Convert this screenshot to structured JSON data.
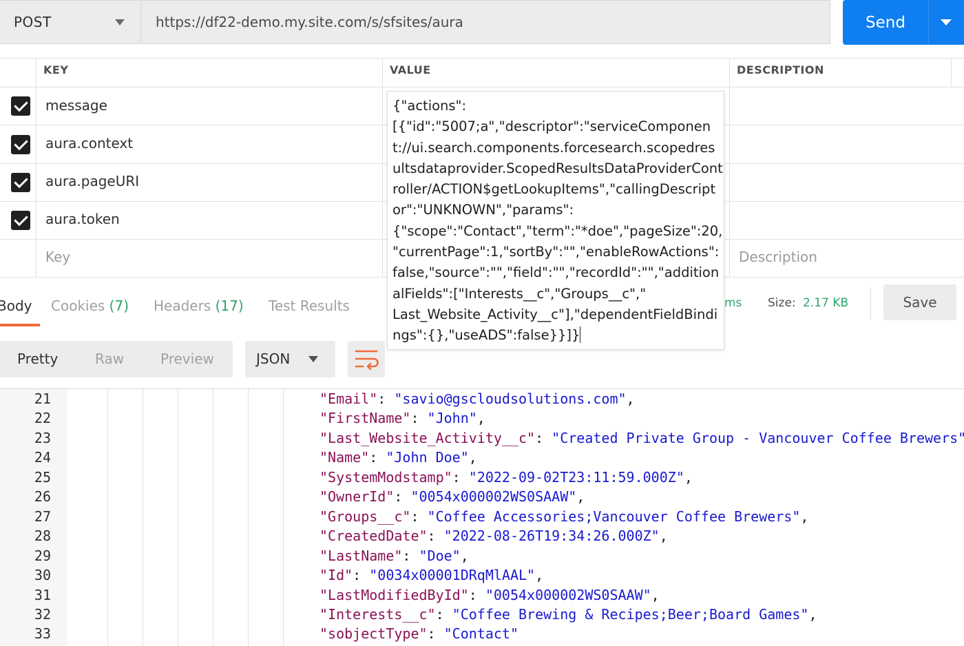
{
  "request": {
    "method": "POST",
    "url": "https://df22-demo.my.site.com/s/sfsites/aura",
    "send_label": "Send"
  },
  "params": {
    "headers": [
      "KEY",
      "VALUE",
      "DESCRIPTION"
    ],
    "rows": [
      {
        "key": "message",
        "checked": true
      },
      {
        "key": "aura.context",
        "checked": true
      },
      {
        "key": "aura.pageURI",
        "checked": true
      },
      {
        "key": "aura.token",
        "checked": true
      }
    ],
    "new_key_placeholder": "Key",
    "new_description_placeholder": "Description",
    "value_editor_text": "{\"actions\":\n[{\"id\":\"5007;a\",\"descriptor\":\"serviceComponent://ui.search.components.forcesearch.scopedresultsdataprovider.ScopedResultsDataProviderController/ACTION$getLookupItems\",\"callingDescriptor\":\"UNKNOWN\",\"params\":\n{\"scope\":\"Contact\",\"term\":\"*doe\",\"pageSize\":20,\n\"currentPage\":1,\"sortBy\":\"\",\"enableRowActions\":\nfalse,\"source\":\"\",\"field\":\"\",\"recordId\":\"\",\"additionalFields\":[\"Interests__c\",\"Groups__c\",\"\nLast_Website_Activity__c\"],\"dependentFieldBindings\":{},\"useADS\":false}}]}"
  },
  "response": {
    "tabs": [
      {
        "label": "Body",
        "count": ""
      },
      {
        "label": "Cookies",
        "count": "(7)"
      },
      {
        "label": "Headers",
        "count": "(17)"
      },
      {
        "label": "Test Results",
        "count": ""
      }
    ],
    "time_text": "ms",
    "size_label": "Size:",
    "size_value": "2.17 KB",
    "save_label": "Save",
    "views": [
      "Pretty",
      "Raw",
      "Preview"
    ],
    "format": "JSON",
    "lines": [
      {
        "n": "21",
        "key": "\"Email\"",
        "value": "\"savio@gscloudsolutions.com\"",
        "comma": ","
      },
      {
        "n": "22",
        "key": "\"FirstName\"",
        "value": "\"John\"",
        "comma": ","
      },
      {
        "n": "23",
        "key": "\"Last_Website_Activity__c\"",
        "value": "\"Created Private Group - Vancouver Coffee Brewers\"",
        "comma": ","
      },
      {
        "n": "24",
        "key": "\"Name\"",
        "value": "\"John Doe\"",
        "comma": ","
      },
      {
        "n": "25",
        "key": "\"SystemModstamp\"",
        "value": "\"2022-09-02T23:11:59.000Z\"",
        "comma": ","
      },
      {
        "n": "26",
        "key": "\"OwnerId\"",
        "value": "\"0054x000002WS0SAAW\"",
        "comma": ","
      },
      {
        "n": "27",
        "key": "\"Groups__c\"",
        "value": "\"Coffee Accessories;Vancouver Coffee Brewers\"",
        "comma": ","
      },
      {
        "n": "28",
        "key": "\"CreatedDate\"",
        "value": "\"2022-08-26T19:34:26.000Z\"",
        "comma": ","
      },
      {
        "n": "29",
        "key": "\"LastName\"",
        "value": "\"Doe\"",
        "comma": ","
      },
      {
        "n": "30",
        "key": "\"Id\"",
        "value": "\"0034x00001DRqMlAAL\"",
        "comma": ","
      },
      {
        "n": "31",
        "key": "\"LastModifiedById\"",
        "value": "\"0054x000002WS0SAAW\"",
        "comma": ","
      },
      {
        "n": "32",
        "key": "\"Interests__c\"",
        "value": "\"Coffee Brewing & Recipes;Beer;Board Games\"",
        "comma": ","
      },
      {
        "n": "33",
        "key": "\"sobjectType\"",
        "value": "\"Contact\"",
        "comma": ""
      }
    ]
  },
  "colors": {
    "accent": "#0e7ef0",
    "tab_underline": "#f26b3a",
    "count": "#2aa56a",
    "json_key": "#8a1256",
    "json_string": "#1a1ad0"
  }
}
